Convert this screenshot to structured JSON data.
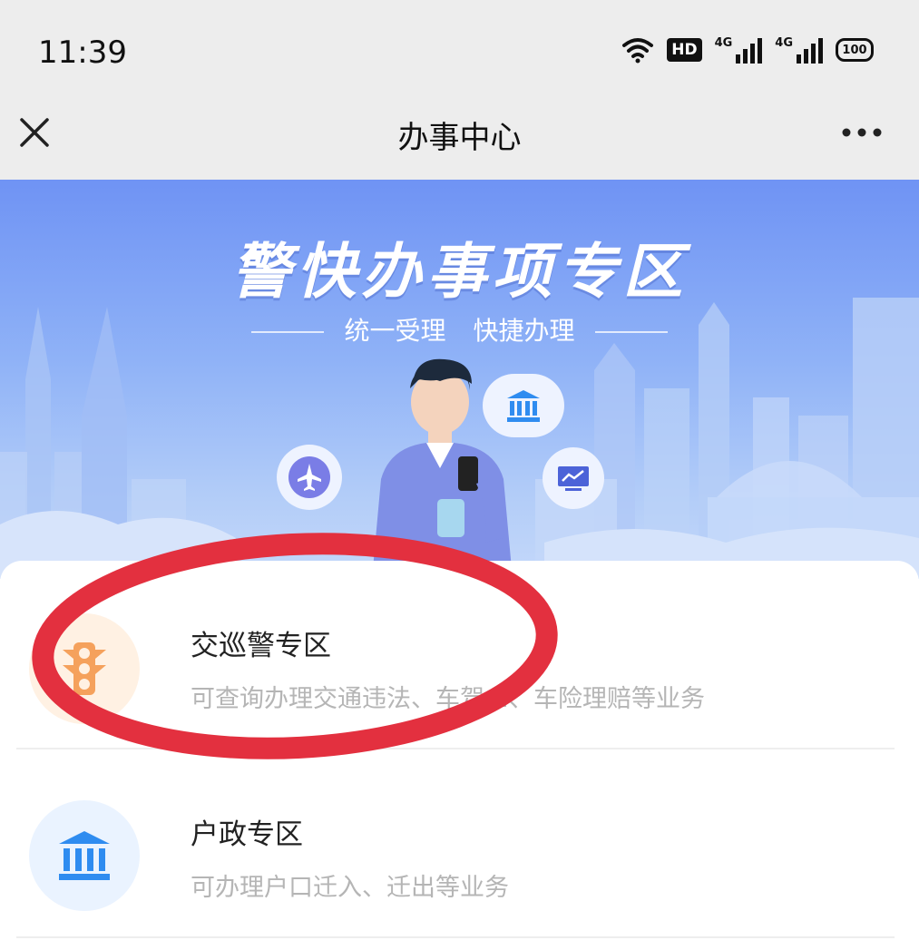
{
  "status_bar": {
    "time": "11:39",
    "hd_label": "HD",
    "network_1": "4G",
    "network_2": "4G",
    "battery": "100",
    "icons": [
      "wifi-icon",
      "hd-voice-icon",
      "signal-icon",
      "signal-icon",
      "battery-icon"
    ]
  },
  "nav": {
    "title": "办事中心",
    "close_icon": "close-icon",
    "more_icon": "more-icon"
  },
  "banner": {
    "title": "警快办事项专区",
    "subtitle_left": "统一受理",
    "subtitle_right": "快捷办理",
    "bubbles": [
      "airplane-icon",
      "bank-icon",
      "chart-icon"
    ]
  },
  "services": [
    {
      "title": "交巡警专区",
      "desc": "可查询办理交通违法、车驾…、车险理赔等业务",
      "icon": "traffic-light-icon",
      "icon_bg": "#fff1e3",
      "icon_color": "#f5a15c"
    },
    {
      "title": "户政专区",
      "desc": "可办理户口迁入、迁出等业务",
      "icon": "bank-icon",
      "icon_bg": "#eaf3ff",
      "icon_color": "#2f8cf0"
    }
  ],
  "annotation": {
    "shape": "ellipse",
    "color": "#e3303f",
    "target": "交巡警专区"
  }
}
